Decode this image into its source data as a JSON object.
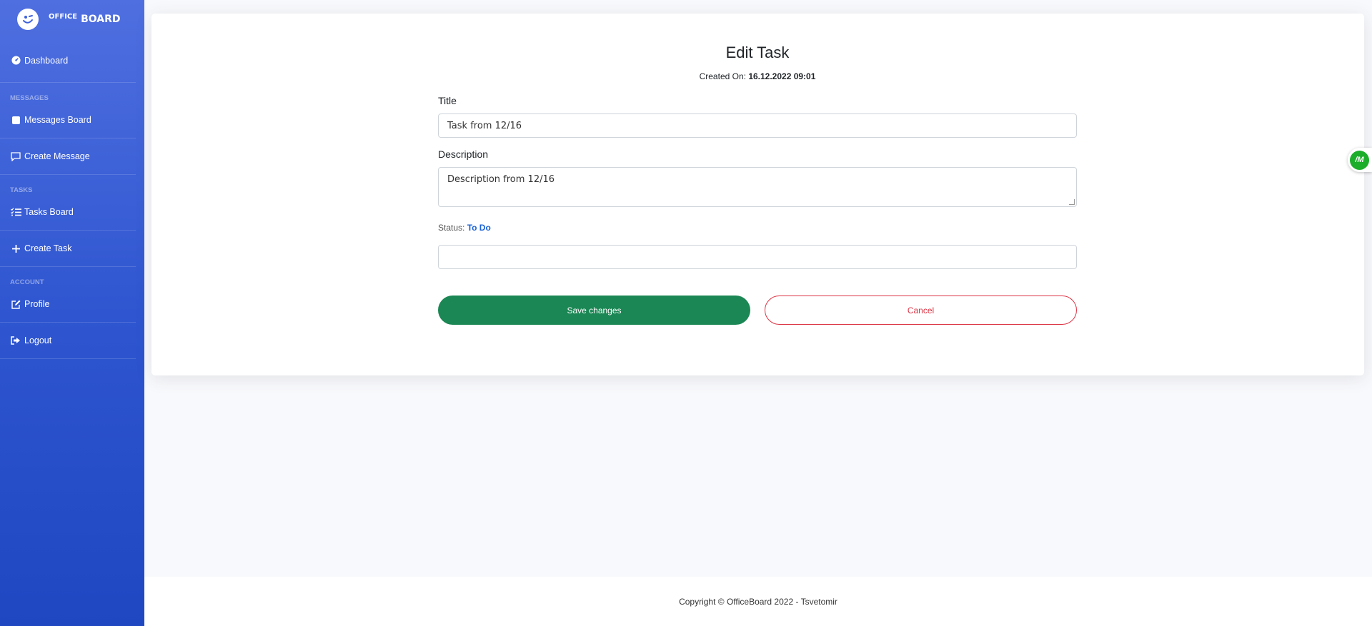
{
  "brand": {
    "small": "OFFICE",
    "big": "BOARD"
  },
  "sidebar": {
    "dashboard": "Dashboard",
    "heading_messages": "MESSAGES",
    "messages_board": "Messages Board",
    "create_message": "Create Message",
    "heading_tasks": "TASKS",
    "tasks_board": "Tasks Board",
    "create_task": "Create Task",
    "heading_account": "ACCOUNT",
    "profile": "Profile",
    "logout": "Logout"
  },
  "form": {
    "heading": "Edit Task",
    "created_label": "Created On:",
    "created_value": "16.12.2022 09:01",
    "title_label": "Title",
    "title_value": "Task from 12/16",
    "description_label": "Description",
    "description_value": "Description from 12/16",
    "status_label": "Status:",
    "status_value": "To Do",
    "extra_value": "",
    "save_label": "Save changes",
    "cancel_label": "Cancel"
  },
  "floater": {
    "text": "/M"
  },
  "footer": {
    "text": "Copyright © OfficeBoard 2022 - Tsvetomir"
  },
  "colors": {
    "sidebar_top": "#4f6fe0",
    "sidebar_bottom": "#1f47c2",
    "save": "#1b8754",
    "cancel": "#dc3545",
    "status": "#1c63d6"
  }
}
